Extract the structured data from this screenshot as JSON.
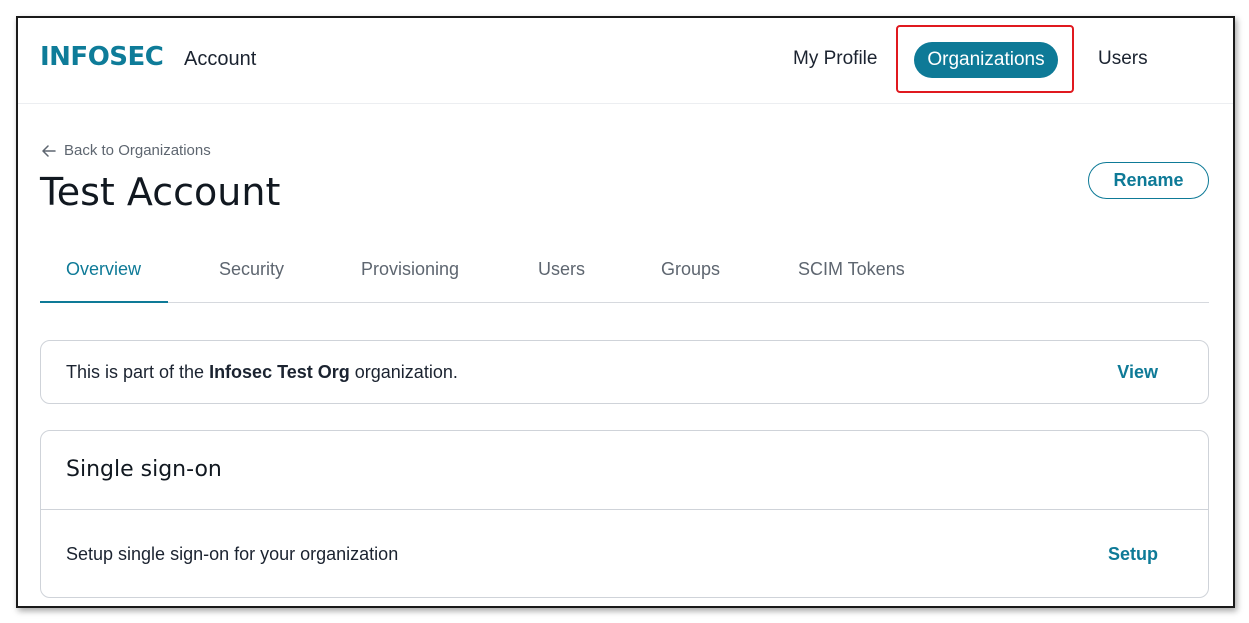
{
  "header": {
    "logo": "INFOSEC",
    "logo_suffix": "Account",
    "nav": {
      "my_profile": "My Profile",
      "organizations": "Organizations",
      "users": "Users"
    }
  },
  "page": {
    "back_link": "Back to Organizations",
    "title": "Test Account",
    "rename_button": "Rename"
  },
  "tabs": [
    {
      "label": "Overview",
      "active": true
    },
    {
      "label": "Security",
      "active": false
    },
    {
      "label": "Provisioning",
      "active": false
    },
    {
      "label": "Users",
      "active": false
    },
    {
      "label": "Groups",
      "active": false
    },
    {
      "label": "SCIM Tokens",
      "active": false
    }
  ],
  "org_card": {
    "text_before": "This is part of the ",
    "org_name": "Infosec Test Org",
    "text_after": " organization.",
    "action": "View"
  },
  "sso_card": {
    "title": "Single sign-on",
    "description": "Setup single sign-on for your organization",
    "action": "Setup"
  },
  "colors": {
    "brand": "#0e7a97",
    "highlight": "#e0191f"
  }
}
